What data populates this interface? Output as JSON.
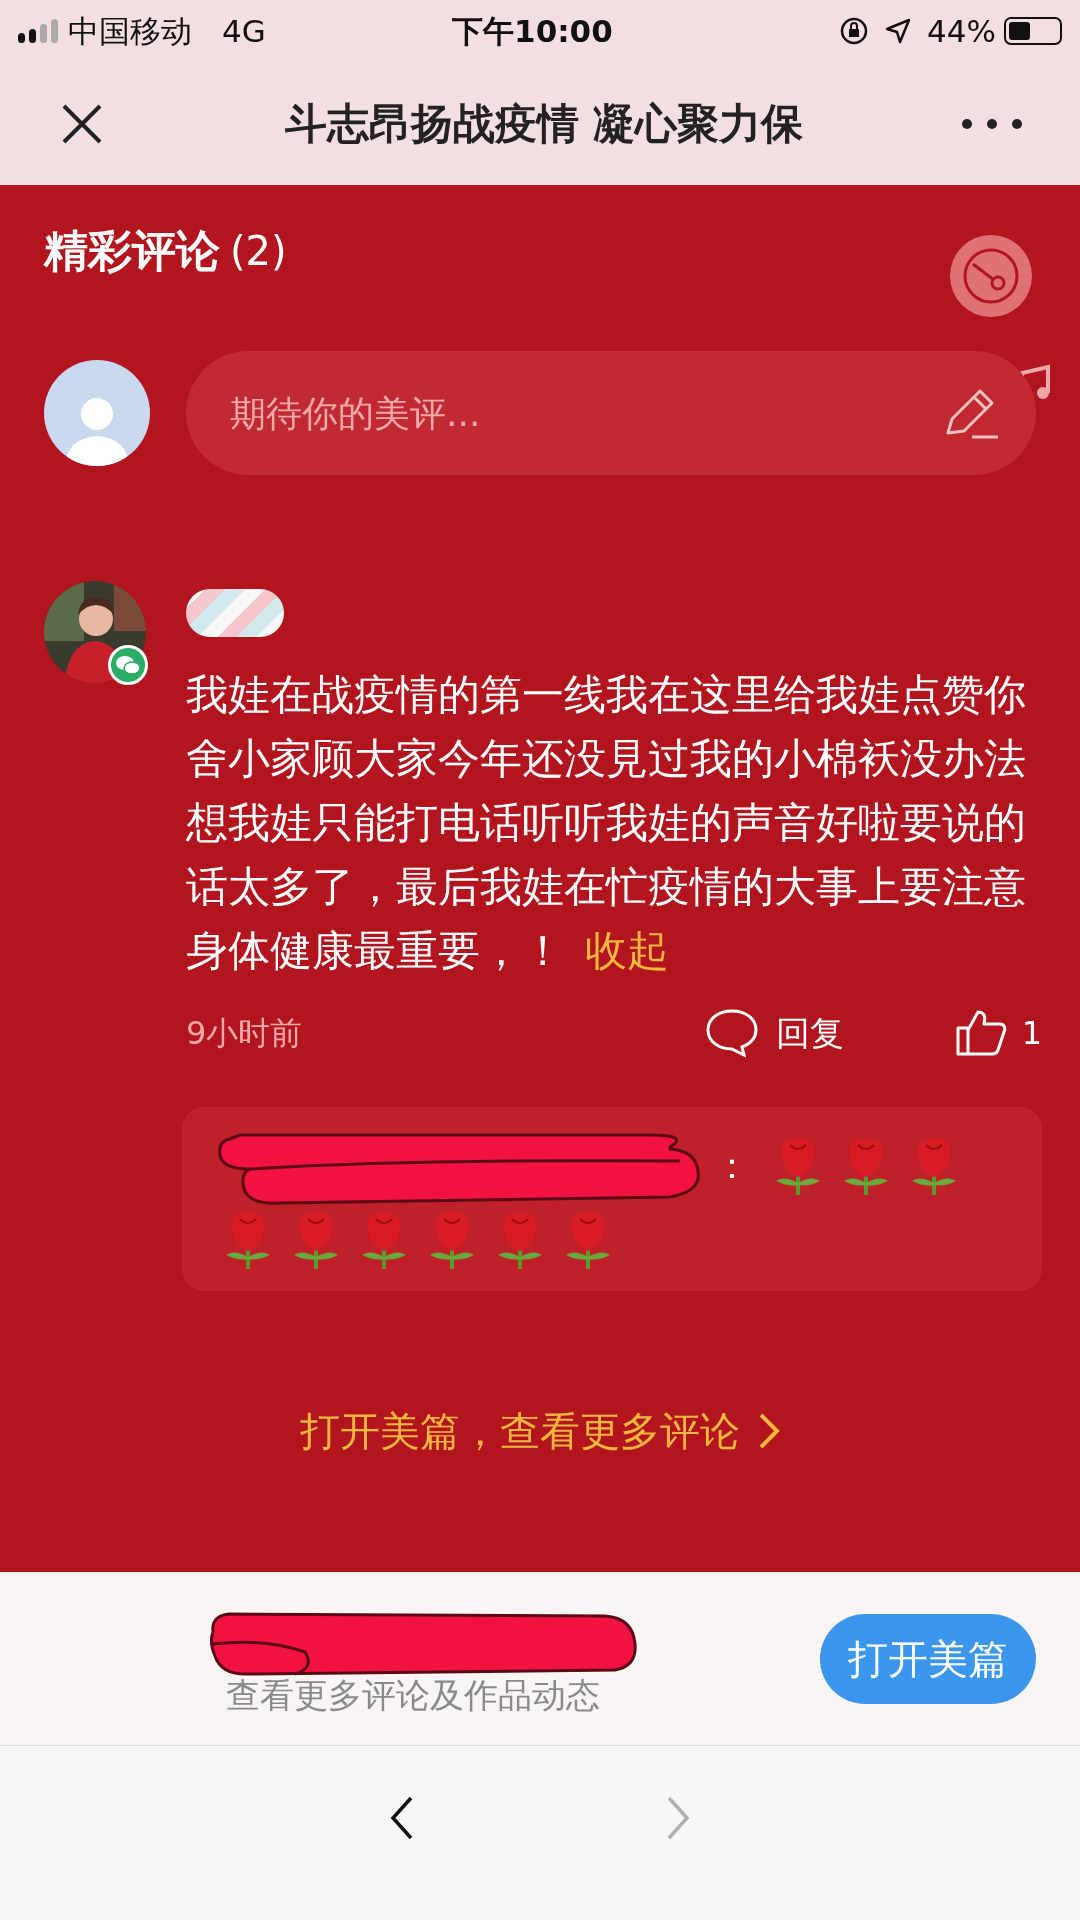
{
  "status_bar": {
    "carrier": "中国移动",
    "network": "4G",
    "time": "下午10:00",
    "battery_percent": "44%"
  },
  "header": {
    "title": "斗志昂扬战疫情 凝心聚力保"
  },
  "comments_section": {
    "title": "精彩评论",
    "count": "(2)",
    "input": {
      "placeholder": "期待你的美评..."
    }
  },
  "comments": [
    {
      "text": "我娃在战疫情的第一线我在这里给我娃点赞你舍小家顾大家今年还没見过我的小棉袄没办法想我娃只能打电话听听我娃的声音好啦要说的话太多了，最后我娃在忙疫情的大事上要注意身体健康最重要，！",
      "collapse": "收起",
      "time": "9小时前",
      "reply_label": "回复",
      "likes": "1",
      "reply": {
        "colon": "：",
        "reactions": [
          {
            "kind": "rose"
          },
          {
            "kind": "rose"
          },
          {
            "kind": "rose"
          },
          {
            "kind": "rose"
          },
          {
            "kind": "rose"
          },
          {
            "kind": "rose"
          },
          {
            "kind": "rose"
          },
          {
            "kind": "rose"
          },
          {
            "kind": "rose"
          }
        ]
      }
    }
  ],
  "more_link": "打开美篇，查看更多评论",
  "banner": {
    "subtitle": "查看更多评论及作品动态",
    "button": "打开美篇"
  },
  "toolbar": {
    "back_disabled": false,
    "forward_disabled": true
  }
}
